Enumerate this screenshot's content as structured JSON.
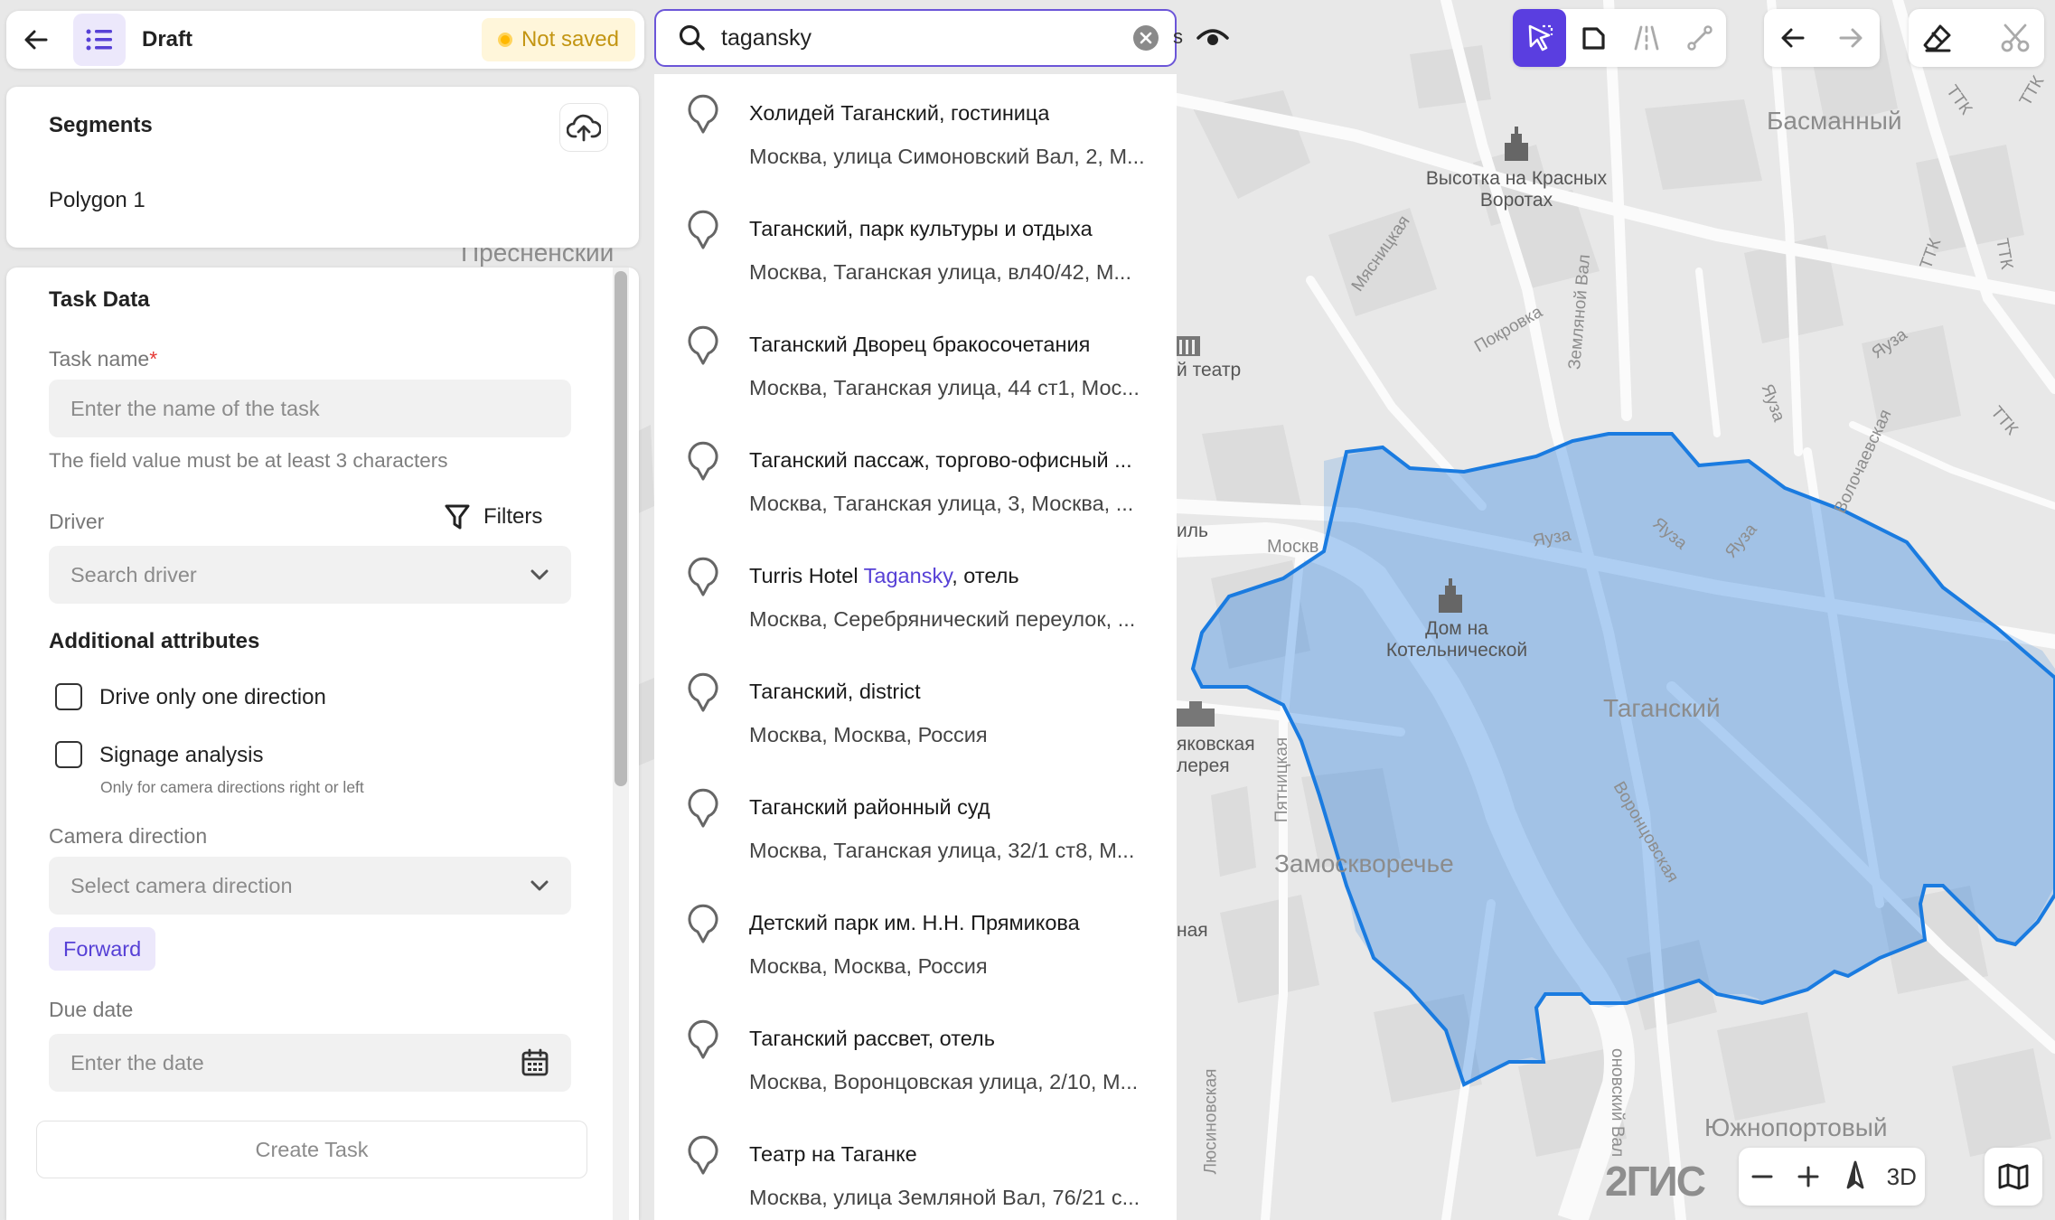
{
  "header": {
    "title": "Draft",
    "status": "Not saved"
  },
  "search": {
    "value": "taganskу",
    "placeholder": "",
    "partial_text": "s"
  },
  "results": [
    {
      "title": "Холидей Таганский, гостиница",
      "subtitle": "Москва, улица Симоновский Вал, 2, М..."
    },
    {
      "title": "Таганский, парк культуры и отдыха",
      "subtitle": "Москва, Таганская улица, вл40/42, М..."
    },
    {
      "title": "Таганский Дворец бракосочетания",
      "subtitle": "Москва, Таганская улица, 44 ст1, Мос..."
    },
    {
      "title": "Таганский пассаж, торгово-офисный ...",
      "subtitle": "Москва, Таганская улица, 3, Москва, ..."
    },
    {
      "title_before": "Turris Hotel ",
      "title_highlight": "Tagansky",
      "title_after": ", отель",
      "subtitle": "Москва, Серебрянический переулок, ..."
    },
    {
      "title": "Таганский, district",
      "subtitle": "Москва, Москва, Россия"
    },
    {
      "title": "Таганский районный суд",
      "subtitle": "Москва, Таганская улица, 32/1 ст8, М..."
    },
    {
      "title": "Детский парк им. Н.Н. Прямикова",
      "subtitle": "Москва, Москва, Россия"
    },
    {
      "title": "Таганский рассвет, отель",
      "subtitle": "Москва, Воронцовская улица, 2/10, М..."
    },
    {
      "title": "Театр на Таганке",
      "subtitle": "Москва, улица Земляной Вал, 76/21 с..."
    }
  ],
  "segments": {
    "heading": "Segments",
    "items": [
      "Polygon 1"
    ]
  },
  "task": {
    "heading": "Task Data",
    "name_label": "Task name",
    "name_required_mark": "*",
    "name_placeholder": "Enter the name of the task",
    "name_hint": "The field value must be at least 3 characters",
    "driver_label": "Driver",
    "filters_label": "Filters",
    "driver_placeholder": "Search driver",
    "attributes_heading": "Additional attributes",
    "cb_one_direction": "Drive only one direction",
    "cb_signage": "Signage analysis",
    "cb_signage_hint": "Only for camera directions right or left",
    "camera_label": "Camera direction",
    "camera_placeholder": "Select camera direction",
    "camera_chip": "Forward",
    "due_label": "Due date",
    "due_placeholder": "Enter the date",
    "create_button": "Create Task"
  },
  "map": {
    "labels": {
      "basmanny": "Басманный",
      "vysotka": "Высотка на Красных\nВоротах",
      "myasnitskaya": "Мясницкая",
      "pokrovka": "Покровка",
      "zemlyanoy": "Земляной Вал",
      "yauza1": "Яуза",
      "yauza2": "Яуза",
      "yauza3": "Яуза",
      "yauza4": "Яуза",
      "yauza5": "Яуза",
      "volochaevskaya": "Волочаевская",
      "ttk1": "ТТК",
      "ttk2": "ТТК",
      "ttk3": "ТТК",
      "ttk4": "ТТК",
      "ttk5": "ТТК",
      "theatre": "й театр",
      "moskva_river": "Москв",
      "il": "иль",
      "dom_kotel": "Дом на\nКотельнической",
      "tagansky": "Таганский",
      "vorontsovskaya": "Воронцовская",
      "pyatnitskaya": "Пятницкая",
      "yakovskaya": "яковская\nлерея",
      "zamoskvorechye": "Замоскворечье",
      "naya": "ная",
      "lyusinovskaya": "Люсиновская",
      "sukhanovsky": "оновский Вал",
      "yuzhnoportovy": "Южнопортовый",
      "presnensky": "Пресненский"
    },
    "polygon_color": "#1a7be0"
  },
  "controls": {
    "threeD": "3D",
    "logo": "2ГИС"
  }
}
